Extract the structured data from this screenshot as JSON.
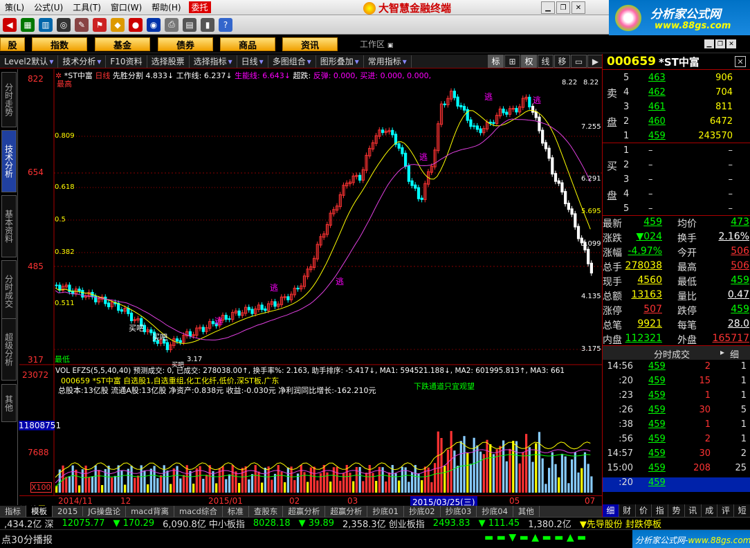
{
  "menu": [
    "策(L)",
    "公式(U)",
    "工具(T)",
    "窗口(W)",
    "帮助(H)"
  ],
  "weituo": "委托",
  "brand": "大智慧金融终端",
  "watermark": {
    "title": "分析家公式网",
    "url": "www.88gs.com"
  },
  "nav": {
    "items": [
      "股",
      "指数",
      "基金",
      "债券",
      "商品",
      "资讯"
    ],
    "workarea": "工作区"
  },
  "tabs": [
    {
      "label": "Level2默认"
    },
    {
      "label": "技术分析"
    },
    {
      "label": "F10资料"
    },
    {
      "label": "选择股票"
    },
    {
      "label": "选择指标"
    },
    {
      "label": "日线"
    },
    {
      "label": "多图组合"
    },
    {
      "label": "图形叠加"
    },
    {
      "label": "常用指标"
    }
  ],
  "right_tools": [
    "标",
    "⊞",
    "权",
    "线",
    "移",
    "▭",
    "▶"
  ],
  "vtabs": [
    "分时走势",
    "技术分析",
    "基本资料",
    "分时成交",
    "超级分析",
    "其他"
  ],
  "chart": {
    "info_line": {
      "name": "*ST中富",
      "period": "日线",
      "indicator": "先胜分割",
      "v1": "4.833↓",
      "work": "工作线: 6.237↓",
      "energy": "生能线: 6.643↓",
      "chaodie": "超跌:",
      "fantan": "反弹: 0.000,",
      "mairu": "买进: 0.000, 0.000,"
    },
    "price_labels": [
      "822",
      "654",
      "485",
      "317"
    ],
    "left_fib": [
      "0.809",
      "0.618",
      "0.5",
      "0.382"
    ],
    "right_levels": [
      "8.22",
      "7.255",
      "6.291",
      "5.695",
      "5.099",
      "4.135",
      "3.175"
    ],
    "tags": {
      "high_left": "最高",
      "low_left": "最低",
      "low_val": "3.17",
      "buy1": "买吧",
      "buy2": "买吧",
      "buy3": "买吧",
      "run": "逃",
      "high_val": "8.22",
      "zuo": "0.511"
    },
    "vol_line": "VOL EFZS(5,5,40,40)  预测成交: 0,  已成交: 278038.00↑,  换手率%: 2.163, 助手排序: -5.417↓,  MA1: 594521.188↓,  MA2: 601995.813↑,  MA3: 661",
    "stock_line": "000659 *ST中富  自选股1,自选重组,化工化纤,低价,深ST板,广东",
    "fund_line": "总股本:13亿股  流通A股:13亿股   净资产:0.838元   收益:-0.030元   净利润同比增长:-162.210元",
    "green_note": "下跌通道只宜观望",
    "vol_labels": [
      "23072",
      "11808751",
      "7688",
      "X100"
    ],
    "x_labels": [
      "2014/11",
      "12",
      "2015/01",
      "02",
      "03",
      "04",
      "05",
      "07"
    ],
    "cursor_date": "2015/03/25(三)"
  },
  "bottom_tabs": [
    "指标",
    "模板",
    "2015",
    "JG操盘论",
    "macd背离",
    "macd综合",
    "标准",
    "查股东",
    "超赢分析",
    "超赢分析",
    "抄底01",
    "抄底02",
    "抄底03",
    "抄底04",
    "其他"
  ],
  "status1": [
    {
      "t": ",434.2亿 深",
      "c": "#ddd"
    },
    {
      "t": "12075.77",
      "c": "#0f0"
    },
    {
      "t": "▼ 170.29",
      "c": "#0f0"
    },
    {
      "t": "6,090.8亿 中小板指",
      "c": "#ddd"
    },
    {
      "t": "8028.18",
      "c": "#0f0"
    },
    {
      "t": "▼ 39.89",
      "c": "#0f0"
    },
    {
      "t": "2,358.3亿 创业板指",
      "c": "#ddd"
    },
    {
      "t": "2493.83",
      "c": "#0f0"
    },
    {
      "t": "▼ 111.45",
      "c": "#0f0"
    },
    {
      "t": "1,380.2亿",
      "c": "#ddd"
    },
    {
      "t": "▼先导股份 封跌停板",
      "c": "#ff0"
    }
  ],
  "status2": "点30分播报",
  "rp": {
    "code": "000659",
    "name": "*ST中富",
    "sell": [
      {
        "lv": "5",
        "pr": "463",
        "vol": "906"
      },
      {
        "lv": "4",
        "pr": "462",
        "vol": "704"
      },
      {
        "lv": "3",
        "pr": "461",
        "vol": "811"
      },
      {
        "lv": "2",
        "pr": "460",
        "vol": "6472"
      },
      {
        "lv": "1",
        "pr": "459",
        "vol": "243570"
      }
    ],
    "buy": [
      {
        "lv": "1",
        "pr": "–",
        "vol": "–"
      },
      {
        "lv": "2",
        "pr": "–",
        "vol": "–"
      },
      {
        "lv": "3",
        "pr": "–",
        "vol": "–"
      },
      {
        "lv": "4",
        "pr": "–",
        "vol": "–"
      },
      {
        "lv": "5",
        "pr": "–",
        "vol": "–"
      }
    ],
    "sell_label": [
      "卖",
      "盘"
    ],
    "buy_label": [
      "买",
      "盘"
    ],
    "quote": [
      {
        "l1": "最新",
        "v1": "459",
        "c1": "#0f0",
        "l2": "均价",
        "v2": "473",
        "c2": "#0f0"
      },
      {
        "l1": "涨跌",
        "v1": "▼024",
        "c1": "#0f0",
        "l2": "换手",
        "v2": "2.16%",
        "c2": "#fff"
      },
      {
        "l1": "涨幅",
        "v1": "-4.97%",
        "c1": "#0f0",
        "l2": "今开",
        "v2": "506",
        "c2": "#f33"
      },
      {
        "l1": "总手",
        "v1": "278038",
        "c1": "#ff0",
        "l2": "最高",
        "v2": "506",
        "c2": "#f33"
      },
      {
        "l1": "现手",
        "v1": "4560",
        "c1": "#ff0",
        "l2": "最低",
        "v2": "459",
        "c2": "#0f0"
      },
      {
        "l1": "总额",
        "v1": "13163",
        "c1": "#ff0",
        "l2": "量比",
        "v2": "0.47",
        "c2": "#fff"
      },
      {
        "l1": "涨停",
        "v1": "507",
        "c1": "#f33",
        "l2": "跌停",
        "v2": "459",
        "c2": "#0f0"
      },
      {
        "l1": "总笔",
        "v1": "9921",
        "c1": "#ff0",
        "l2": "每笔",
        "v2": "28.0",
        "c2": "#fff"
      },
      {
        "l1": "内盘",
        "v1": "112321",
        "c1": "#0f0",
        "l2": "外盘",
        "v2": "165717",
        "c2": "#f33"
      }
    ],
    "fs_title": "分时成交",
    "fs_btn": "细",
    "ticks": [
      {
        "t": "14:56",
        "p": "459",
        "v": "2",
        "n": "1"
      },
      {
        "t": ":20",
        "p": "459",
        "v": "15",
        "n": "1"
      },
      {
        "t": ":23",
        "p": "459",
        "v": "1",
        "n": "1"
      },
      {
        "t": ":26",
        "p": "459",
        "v": "30",
        "n": "5"
      },
      {
        "t": ":38",
        "p": "459",
        "v": "1",
        "n": "1"
      },
      {
        "t": ":56",
        "p": "459",
        "v": "2",
        "n": "1"
      },
      {
        "t": "14:57",
        "p": "459",
        "v": "30",
        "n": "2"
      },
      {
        "t": "15:00",
        "p": "459",
        "v": "208",
        "n": "25"
      },
      {
        "t": ":20",
        "p": "459",
        "v": "",
        "n": ""
      }
    ],
    "bottom_tabs": [
      "细",
      "财",
      "价",
      "指",
      "势",
      "讯",
      "成",
      "评",
      "短"
    ]
  }
}
